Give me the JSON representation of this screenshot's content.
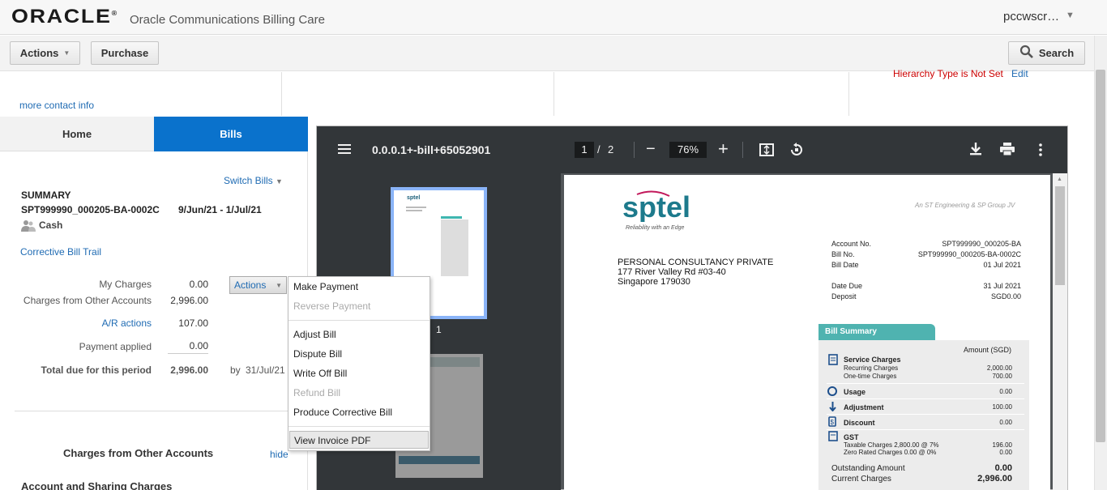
{
  "app": {
    "logo": "ORACLE",
    "logo_mark": "®",
    "title": "Oracle Communications Billing Care",
    "user": "pccwscr…"
  },
  "toolbar": {
    "actions": "Actions",
    "purchase": "Purchase",
    "search": "Search"
  },
  "info": {
    "hierarchy": "Hierarchy Type is Not Set",
    "edit": "Edit",
    "more_contact": "more contact info"
  },
  "tabs": {
    "home": "Home",
    "bills": "Bills"
  },
  "summary": {
    "switch_bills": "Switch Bills",
    "heading": "SUMMARY",
    "bill_id": "SPT999990_000205-BA-0002C",
    "period": "9/Jun/21 - 1/Jul/21",
    "payment_type": "Cash",
    "corrective_trail": "Corrective Bill Trail",
    "rows": {
      "my_charges": {
        "label": "My Charges",
        "value": "0.00"
      },
      "other_accounts": {
        "label": "Charges from Other Accounts",
        "value": "2,996.00"
      },
      "ar_actions": {
        "label": "A/R actions",
        "value": "107.00"
      },
      "payment_applied": {
        "label": "Payment applied",
        "value": "0.00"
      },
      "total_due": {
        "label": "Total due for this period",
        "value": "2,996.00",
        "by": "by",
        "due_date": "31/Jul/21"
      }
    },
    "actions_button": "Actions",
    "other_heading": "Charges from Other Accounts",
    "hide": "hide",
    "sharing_heading": "Account and Sharing Charges"
  },
  "menu": {
    "make_payment": "Make Payment",
    "reverse_payment": "Reverse Payment",
    "adjust_bill": "Adjust Bill",
    "dispute_bill": "Dispute Bill",
    "write_off_bill": "Write Off Bill",
    "refund_bill": "Refund Bill",
    "produce_corrective": "Produce Corrective Bill",
    "view_invoice": "View Invoice PDF"
  },
  "pdf": {
    "filename": "0.0.0.1+-bill+65052901",
    "page": "1",
    "page_sep": "/",
    "pages": "2",
    "zoom": "76%",
    "thumb_label": "1"
  },
  "invoice": {
    "logo": "sptel",
    "tagline": "Reliability with an Edge",
    "jv": "An ST Engineering & SP Group JV",
    "customer": [
      "PERSONAL CONSULTANCY PRIVATE",
      "177 River Valley Rd #03-40",
      "Singapore 179030"
    ],
    "meta": [
      {
        "label": "Account No.",
        "value": "SPT999990_000205-BA"
      },
      {
        "label": "Bill No.",
        "value": "SPT999990_000205-BA-0002C"
      },
      {
        "label": "Bill Date",
        "value": "01 Jul 2021"
      }
    ],
    "meta2": [
      {
        "label": "Date Due",
        "value": "31 Jul 2021"
      },
      {
        "label": "Deposit",
        "value": "SGD0.00"
      }
    ],
    "summary_title": "Bill Summary",
    "amount_header": "Amount (SGD)",
    "service_charges": "Service Charges",
    "recurring": {
      "label": "Recurring Charges",
      "value": "2,000.00"
    },
    "onetime": {
      "label": "One-time Charges",
      "value": "700.00"
    },
    "usage": {
      "label": "Usage",
      "value": "0.00"
    },
    "adjustment": {
      "label": "Adjustment",
      "value": "100.00"
    },
    "discount": {
      "label": "Discount",
      "value": "0.00"
    },
    "gst": "GST",
    "taxable": {
      "label": "Taxable Charges 2,800.00 @ 7%",
      "value": "196.00"
    },
    "zerorated": {
      "label": "Zero Rated Charges 0.00 @ 0%",
      "value": "0.00"
    },
    "outstanding": {
      "label": "Outstanding Amount",
      "value": "0.00"
    },
    "current": {
      "label": "Current Charges",
      "value": "2,996.00"
    }
  }
}
